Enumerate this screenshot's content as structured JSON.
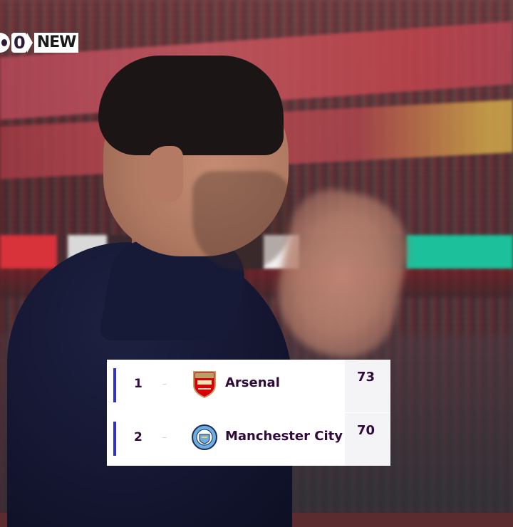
{
  "logo": {
    "mark_icon": "channel-logo-icon",
    "zero": "0",
    "word": "NEW"
  },
  "standings": {
    "rows": [
      {
        "position": "1",
        "movement": "–",
        "crest_icon": "arsenal-crest-icon",
        "team": "Arsenal",
        "points": "73"
      },
      {
        "position": "2",
        "movement": "–",
        "crest_icon": "manchester-city-crest-icon",
        "team": "Manchester City",
        "points": "70"
      }
    ]
  },
  "colors": {
    "accent_bar": "#2f33c9",
    "text": "#2f0a3a",
    "arsenal_red": "#db0007",
    "city_blue": "#6caee0"
  }
}
